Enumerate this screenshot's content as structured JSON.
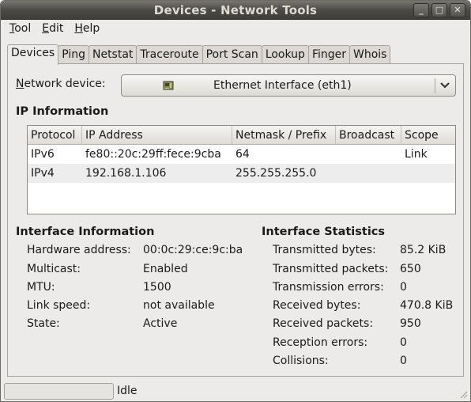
{
  "window": {
    "title": "Devices - Network Tools",
    "minimize": "_",
    "maximize": "□",
    "close": "✕"
  },
  "menubar": [
    {
      "accel": "T",
      "rest": "ool"
    },
    {
      "accel": "E",
      "rest": "dit"
    },
    {
      "accel": "H",
      "rest": "elp"
    }
  ],
  "tabs": [
    "Devices",
    "Ping",
    "Netstat",
    "Traceroute",
    "Port Scan",
    "Lookup",
    "Finger",
    "Whois"
  ],
  "device": {
    "label_accel": "N",
    "label_rest": "etwork device:",
    "selected": "Ethernet Interface (eth1)",
    "icon": "network-card-icon"
  },
  "ip_info": {
    "title": "IP Information",
    "columns": [
      "Protocol",
      "IP Address",
      "Netmask / Prefix",
      "Broadcast",
      "Scope"
    ],
    "rows": [
      [
        "IPv6",
        "fe80::20c:29ff:fece:9cba",
        "64",
        "",
        "Link"
      ],
      [
        "IPv4",
        "192.168.1.106",
        "255.255.255.0",
        "",
        ""
      ]
    ]
  },
  "interface_info": {
    "title": "Interface Information",
    "hardware_label": "Hardware address:",
    "hardware_value": "00:0c:29:ce:9c:ba",
    "multicast_label": "Multicast:",
    "multicast_value": "Enabled",
    "mtu_label": "MTU:",
    "mtu_value": "1500",
    "speed_label": "Link speed:",
    "speed_value": "not available",
    "state_label": "State:",
    "state_value": "Active"
  },
  "interface_stats": {
    "title": "Interface Statistics",
    "tx_bytes_label": "Transmitted bytes:",
    "tx_bytes_value": "85.2 KiB",
    "tx_packets_label": "Transmitted packets:",
    "tx_packets_value": "650",
    "tx_errors_label": "Transmission errors:",
    "tx_errors_value": "0",
    "rx_bytes_label": "Received bytes:",
    "rx_bytes_value": "470.8 KiB",
    "rx_packets_label": "Received packets:",
    "rx_packets_value": "950",
    "rx_errors_label": "Reception errors:",
    "rx_errors_value": "0",
    "collisions_label": "Collisions:",
    "collisions_value": "0"
  },
  "status": {
    "text": "Idle"
  }
}
